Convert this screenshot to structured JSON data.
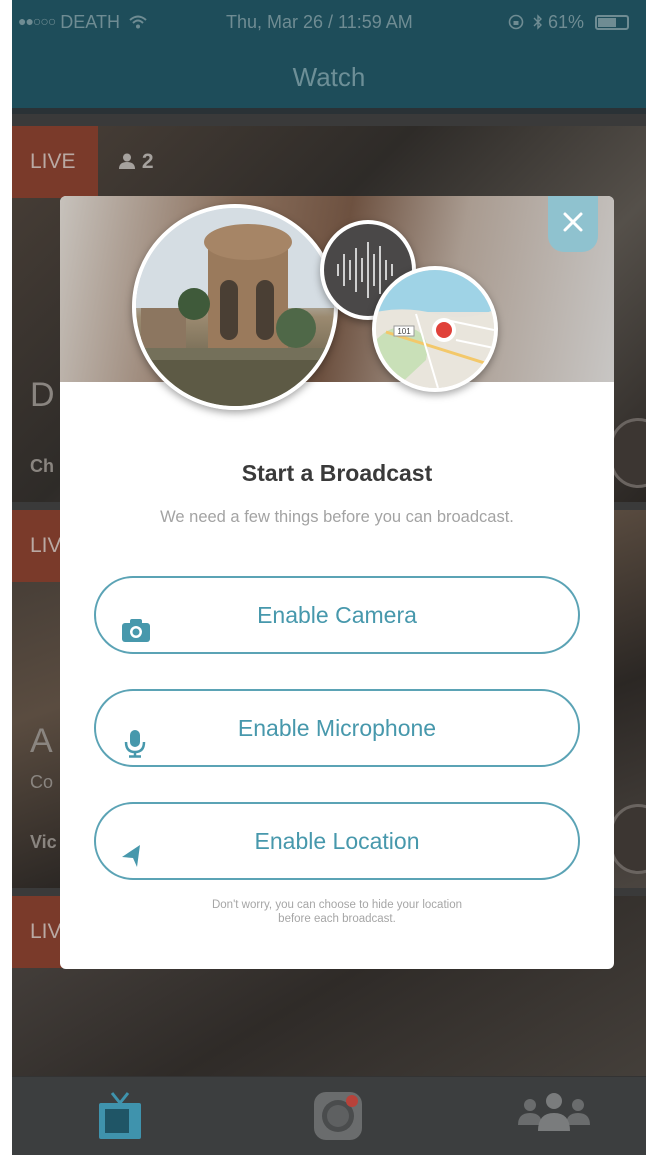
{
  "status_bar": {
    "signal": "●●○○○",
    "carrier": "DEATH",
    "datetime": "Thu, Mar 26 / 11:59 AM",
    "battery": "61%"
  },
  "nav": {
    "title": "Watch"
  },
  "feed": {
    "item1": {
      "live": "LIVE",
      "viewers": "2",
      "title_letter": "D",
      "subtitle": "Ch"
    },
    "item2": {
      "live": "LIV",
      "title_letter": "A",
      "subtitle": "Co",
      "user": "Vic"
    },
    "item3": {
      "live": "LIV"
    }
  },
  "modal": {
    "title": "Start a Broadcast",
    "subtitle": "We need a few things before you can broadcast.",
    "buttons": {
      "camera": "Enable Camera",
      "microphone": "Enable Microphone",
      "location": "Enable Location"
    },
    "note_line1": "Don't worry, you can choose to hide your location",
    "note_line2": "before each broadcast.",
    "map_label": "101"
  },
  "colors": {
    "accent": "#4798ac",
    "nav_bg": "#1e4d5a",
    "live_red": "#7a3a2a",
    "record_red": "#e0413a"
  },
  "icons": {
    "close": "close-icon",
    "camera": "camera-icon",
    "microphone": "microphone-icon",
    "location": "location-arrow-icon",
    "tv": "tv-icon",
    "broadcast": "broadcast-icon",
    "people": "people-icon"
  }
}
